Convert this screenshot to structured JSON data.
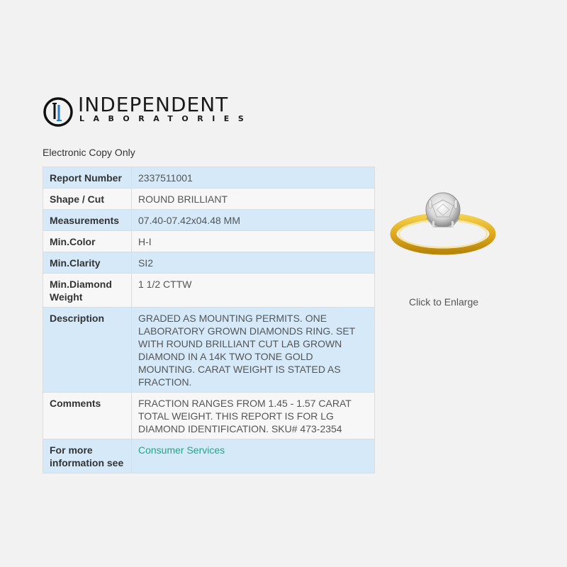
{
  "header": {
    "logo_main": "INDEPENDENT",
    "logo_sub": "LABORATORIES",
    "logo_icon": "il-monogram-icon"
  },
  "subtitle": "Electronic Copy Only",
  "report": {
    "rows": [
      {
        "label": "Report Number",
        "value": "2337511001"
      },
      {
        "label": "Shape / Cut",
        "value": "ROUND BRILLIANT"
      },
      {
        "label": "Measurements",
        "value": "07.40-07.42x04.48 MM"
      },
      {
        "label": "Min.Color",
        "value": "H-I"
      },
      {
        "label": "Min.Clarity",
        "value": "SI2"
      },
      {
        "label": "Min.Diamond Weight",
        "value": "1 1/2 CTTW"
      },
      {
        "label": "Description",
        "value": "GRADED AS MOUNTING PERMITS. ONE LABORATORY GROWN DIAMONDS RING. SET WITH ROUND BRILLIANT CUT LAB GROWN DIAMOND IN A 14K TWO TONE GOLD MOUNTING. CARAT WEIGHT IS STATED AS FRACTION."
      },
      {
        "label": "Comments",
        "value": "FRACTION RANGES FROM 1.45 - 1.57 CARAT TOTAL WEIGHT. THIS REPORT IS FOR LG DIAMOND IDENTIFICATION. SKU# 473-2354"
      },
      {
        "label": "For more information see",
        "value": "Consumer Services"
      }
    ]
  },
  "image": {
    "icon": "ring-image",
    "enlarge_label": "Click to Enlarge"
  },
  "colors": {
    "row_blue": "#d5e9f8",
    "row_white": "#f7f7f7",
    "link": "#1aa88a",
    "background": "#f2f2f2"
  }
}
